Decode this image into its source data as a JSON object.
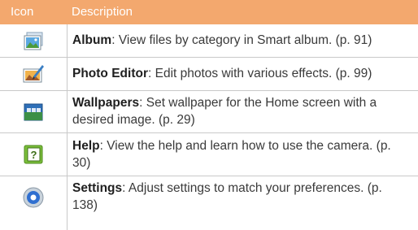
{
  "header": {
    "icon_label": "Icon",
    "description_label": "Description",
    "color": "#f3a86e"
  },
  "rows": [
    {
      "icon": "album-icon",
      "title": "Album",
      "text": ": View files by category in Smart album. (p. 91)"
    },
    {
      "icon": "photo-editor-icon",
      "title": "Photo Editor",
      "text": ": Edit photos with various effects. (p. 99)"
    },
    {
      "icon": "wallpapers-icon",
      "title": "Wallpapers",
      "text": ": Set wallpaper for the Home screen with a desired image. (p. 29)"
    },
    {
      "icon": "help-icon",
      "title": "Help",
      "text": ": View the help and learn how to use the camera. (p. 30)"
    },
    {
      "icon": "settings-icon",
      "title": "Settings",
      "text": ": Adjust settings to match your preferences. (p. 138)"
    }
  ]
}
